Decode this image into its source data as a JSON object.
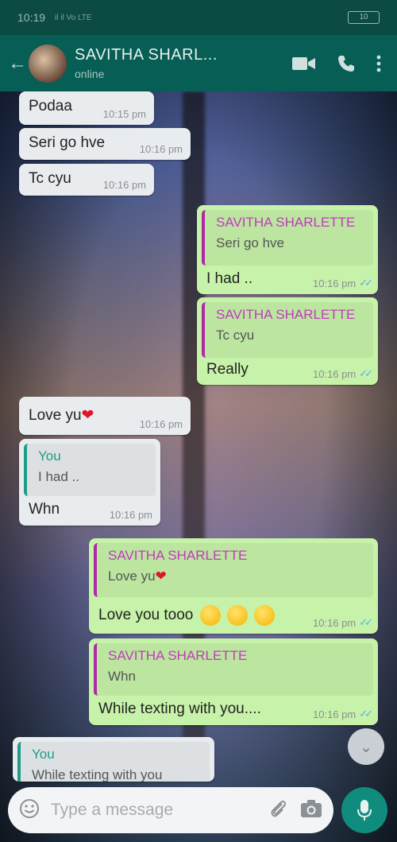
{
  "status_bar": {
    "time": "10:19",
    "signal": "il il Vo LTE",
    "battery": "10"
  },
  "header": {
    "contact_name": "SAVITHA SHARL...",
    "contact_status": "online"
  },
  "messages": [
    {
      "text": "Podaa",
      "time": "10:15 pm"
    },
    {
      "text": "Seri go hve",
      "time": "10:16 pm"
    },
    {
      "text": "Tc cyu",
      "time": "10:16 pm"
    },
    {
      "quote_name": "SAVITHA SHARLETTE",
      "quote_text": "Seri go hve",
      "text": "I had ..",
      "time": "10:16 pm"
    },
    {
      "quote_name": "SAVITHA SHARLETTE",
      "quote_text": "Tc cyu",
      "text": "Really",
      "time": "10:16 pm"
    },
    {
      "text": "Love yu",
      "time": "10:16 pm"
    },
    {
      "quote_name": "You",
      "quote_text": "I had ..",
      "text": "Whn",
      "time": "10:16 pm"
    },
    {
      "quote_name": "SAVITHA SHARLETTE",
      "quote_text": "Love yu",
      "text": "Love you tooo",
      "time": "10:16 pm"
    },
    {
      "quote_name": "SAVITHA SHARLETTE",
      "quote_text": "Whn",
      "text": "While texting with you....",
      "time": "10:16 pm"
    },
    {
      "quote_name": "You",
      "quote_text": "While texting with you"
    }
  ],
  "input": {
    "placeholder": "Type a message"
  },
  "icons": {
    "back": "back-arrow-icon",
    "video": "video-call-icon",
    "call": "phone-icon",
    "menu": "more-vert-icon",
    "emoji": "emoji-icon",
    "attach": "attach-icon",
    "camera": "camera-icon",
    "mic": "mic-icon",
    "scroll": "scroll-down-icon"
  },
  "colors": {
    "header": "#075e54",
    "outgoing": "#c7f2a9",
    "incoming": "#e9ecef",
    "quote_name": "#c13bbd",
    "mic": "#0f8c7e",
    "ticks": "#4fb3e8"
  }
}
